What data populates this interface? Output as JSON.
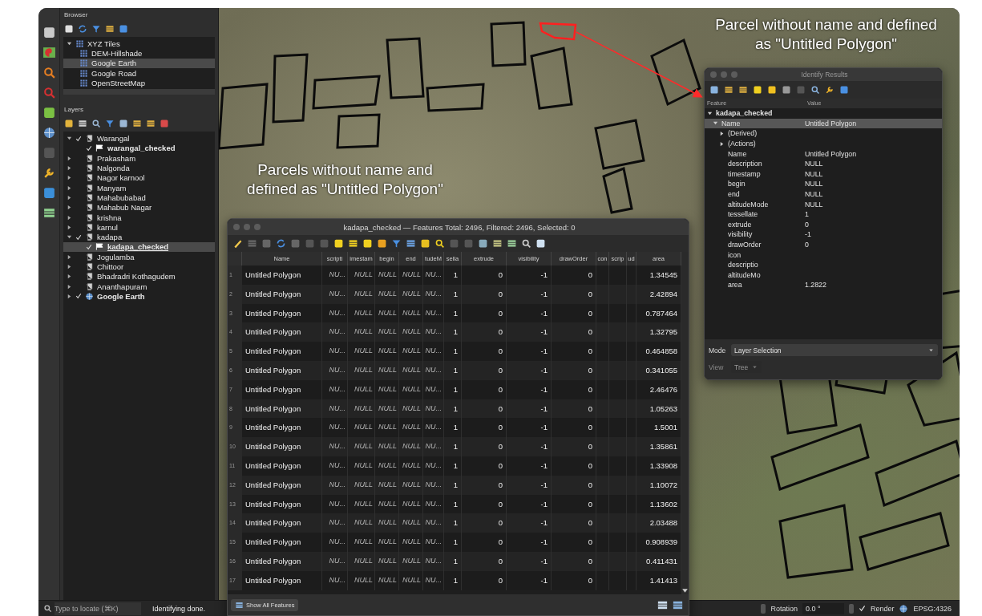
{
  "browser": {
    "title": "Browser",
    "items": [
      {
        "label": "XYZ Tiles",
        "expanded": true,
        "selected": false,
        "children": [
          {
            "label": "DEM-Hillshade",
            "selected": false
          },
          {
            "label": "Google Earth",
            "selected": true
          },
          {
            "label": "Google Road",
            "selected": false
          },
          {
            "label": "OpenStreetMap",
            "selected": false
          }
        ]
      }
    ]
  },
  "layers": {
    "title": "Layers",
    "items": [
      {
        "label": "Warangal",
        "kind": "group",
        "expanded": true,
        "checked": true,
        "selected": false,
        "children": [
          {
            "label": "warangal_checked",
            "kind": "vector",
            "checked": true,
            "selected": false
          }
        ]
      },
      {
        "label": "Prakasham",
        "kind": "group",
        "expanded": false,
        "checked": false,
        "selected": false
      },
      {
        "label": "Nalgonda",
        "kind": "group",
        "expanded": false,
        "checked": false,
        "selected": false
      },
      {
        "label": "Nagor karnool",
        "kind": "group",
        "expanded": false,
        "checked": false,
        "selected": false
      },
      {
        "label": "Manyam",
        "kind": "group",
        "expanded": false,
        "checked": false,
        "selected": false
      },
      {
        "label": "Mahabubabad",
        "kind": "group",
        "expanded": false,
        "checked": false,
        "selected": false
      },
      {
        "label": "Mahabub Nagar",
        "kind": "group",
        "expanded": false,
        "checked": false,
        "selected": false
      },
      {
        "label": "krishna",
        "kind": "group",
        "expanded": false,
        "checked": false,
        "selected": false
      },
      {
        "label": "karnul",
        "kind": "group",
        "expanded": false,
        "checked": false,
        "selected": false
      },
      {
        "label": "kadapa",
        "kind": "group",
        "expanded": true,
        "checked": true,
        "selected": false,
        "children": [
          {
            "label": "kadapa_checked",
            "kind": "vector",
            "checked": true,
            "selected": true
          }
        ]
      },
      {
        "label": "Jogulamba",
        "kind": "group",
        "expanded": false,
        "checked": false,
        "selected": false
      },
      {
        "label": "Chittoor",
        "kind": "group",
        "expanded": false,
        "checked": false,
        "selected": false
      },
      {
        "label": "Bhadradri Kothagudem",
        "kind": "group",
        "expanded": false,
        "checked": false,
        "selected": false
      },
      {
        "label": "Ananthapuram",
        "kind": "group",
        "expanded": false,
        "checked": false,
        "selected": false
      },
      {
        "label": "Google Earth",
        "kind": "raster",
        "expanded": false,
        "checked": true,
        "selected": false
      }
    ]
  },
  "map": {
    "annotations": [
      {
        "text": "Parcel without name and defined as \"Untitled Polygon\""
      },
      {
        "text": "Parcels without name and defined as \"Untitled Polygon\""
      }
    ]
  },
  "attribute_table": {
    "title": "kadapa_checked — Features Total: 2496, Filtered: 2496, Selected: 0",
    "columns": [
      "Name",
      "scripti",
      "imestam",
      "begin",
      "end",
      "tudeM",
      "sella",
      "extrude",
      "visibility",
      "drawOrder",
      "con",
      "scrip",
      "ud",
      "area"
    ],
    "rows": [
      {
        "number": "1",
        "cells": [
          "Untitled Polygon",
          "NU...",
          "NULL",
          "NULL",
          "NULL",
          "NU...",
          "1",
          "0",
          "-1",
          "0",
          null,
          null,
          null,
          "1.34545"
        ]
      },
      {
        "number": "2",
        "cells": [
          "Untitled Polygon",
          "NU...",
          "NULL",
          "NULL",
          "NULL",
          "NU...",
          "1",
          "0",
          "-1",
          "0",
          null,
          null,
          null,
          "2.42894"
        ]
      },
      {
        "number": "3",
        "cells": [
          "Untitled Polygon",
          "NU...",
          "NULL",
          "NULL",
          "NULL",
          "NU...",
          "1",
          "0",
          "-1",
          "0",
          null,
          null,
          null,
          "0.787464"
        ]
      },
      {
        "number": "4",
        "cells": [
          "Untitled Polygon",
          "NU...",
          "NULL",
          "NULL",
          "NULL",
          "NU...",
          "1",
          "0",
          "-1",
          "0",
          null,
          null,
          null,
          "1.32795"
        ]
      },
      {
        "number": "5",
        "cells": [
          "Untitled Polygon",
          "NU...",
          "NULL",
          "NULL",
          "NULL",
          "NU...",
          "1",
          "0",
          "-1",
          "0",
          null,
          null,
          null,
          "0.464858"
        ]
      },
      {
        "number": "6",
        "cells": [
          "Untitled Polygon",
          "NU...",
          "NULL",
          "NULL",
          "NULL",
          "NU...",
          "1",
          "0",
          "-1",
          "0",
          null,
          null,
          null,
          "0.341055"
        ]
      },
      {
        "number": "7",
        "cells": [
          "Untitled Polygon",
          "NU...",
          "NULL",
          "NULL",
          "NULL",
          "NU...",
          "1",
          "0",
          "-1",
          "0",
          null,
          null,
          null,
          "2.46476"
        ]
      },
      {
        "number": "8",
        "cells": [
          "Untitled Polygon",
          "NU...",
          "NULL",
          "NULL",
          "NULL",
          "NU...",
          "1",
          "0",
          "-1",
          "0",
          null,
          null,
          null,
          "1.05263"
        ]
      },
      {
        "number": "9",
        "cells": [
          "Untitled Polygon",
          "NU...",
          "NULL",
          "NULL",
          "NULL",
          "NU...",
          "1",
          "0",
          "-1",
          "0",
          null,
          null,
          null,
          "1.5001"
        ]
      },
      {
        "number": "10",
        "cells": [
          "Untitled Polygon",
          "NU...",
          "NULL",
          "NULL",
          "NULL",
          "NU...",
          "1",
          "0",
          "-1",
          "0",
          null,
          null,
          null,
          "1.35861"
        ]
      },
      {
        "number": "11",
        "cells": [
          "Untitled Polygon",
          "NU...",
          "NULL",
          "NULL",
          "NULL",
          "NU...",
          "1",
          "0",
          "-1",
          "0",
          null,
          null,
          null,
          "1.33908"
        ]
      },
      {
        "number": "12",
        "cells": [
          "Untitled Polygon",
          "NU...",
          "NULL",
          "NULL",
          "NULL",
          "NU...",
          "1",
          "0",
          "-1",
          "0",
          null,
          null,
          null,
          "1.10072"
        ]
      },
      {
        "number": "13",
        "cells": [
          "Untitled Polygon",
          "NU...",
          "NULL",
          "NULL",
          "NULL",
          "NU...",
          "1",
          "0",
          "-1",
          "0",
          null,
          null,
          null,
          "1.13602"
        ]
      },
      {
        "number": "14",
        "cells": [
          "Untitled Polygon",
          "NU...",
          "NULL",
          "NULL",
          "NULL",
          "NU...",
          "1",
          "0",
          "-1",
          "0",
          null,
          null,
          null,
          "2.03488"
        ]
      },
      {
        "number": "15",
        "cells": [
          "Untitled Polygon",
          "NU...",
          "NULL",
          "NULL",
          "NULL",
          "NU...",
          "1",
          "0",
          "-1",
          "0",
          null,
          null,
          null,
          "0.908939"
        ]
      },
      {
        "number": "16",
        "cells": [
          "Untitled Polygon",
          "NU...",
          "NULL",
          "NULL",
          "NULL",
          "NU...",
          "1",
          "0",
          "-1",
          "0",
          null,
          null,
          null,
          "0.411431"
        ]
      },
      {
        "number": "17",
        "cells": [
          "Untitled Polygon",
          "NU...",
          "NULL",
          "NULL",
          "NULL",
          "NU...",
          "1",
          "0",
          "-1",
          "0",
          null,
          null,
          null,
          "1.41413"
        ]
      }
    ],
    "filter_button": "Show All Features"
  },
  "identify_results": {
    "title": "Identify Results",
    "columns": [
      "Feature",
      "Value"
    ],
    "tree": [
      {
        "label": "kadapa_checked",
        "expanded": true,
        "selected": false,
        "children": [
          {
            "label": "Name",
            "value": "Untitled Polygon",
            "expanded": true,
            "selected": true,
            "children": [
              {
                "label": "(Derived)",
                "kind": "section",
                "expanded": false
              },
              {
                "label": "(Actions)",
                "kind": "section",
                "expanded": false
              },
              {
                "label": "Name",
                "value": "Untitled Polygon",
                "kind": "attribute"
              },
              {
                "label": "description",
                "value": "NULL",
                "kind": "attribute"
              },
              {
                "label": "timestamp",
                "value": "NULL",
                "kind": "attribute"
              },
              {
                "label": "begin",
                "value": "NULL",
                "kind": "attribute"
              },
              {
                "label": "end",
                "value": "NULL",
                "kind": "attribute"
              },
              {
                "label": "altitudeMode",
                "value": "NULL",
                "kind": "attribute"
              },
              {
                "label": "tessellate",
                "value": "1",
                "kind": "attribute"
              },
              {
                "label": "extrude",
                "value": "0",
                "kind": "attribute"
              },
              {
                "label": "visibility",
                "value": "-1",
                "kind": "attribute"
              },
              {
                "label": "drawOrder",
                "value": "0",
                "kind": "attribute"
              },
              {
                "label": "icon",
                "kind": "attribute"
              },
              {
                "label": "descriptio",
                "kind": "attribute"
              },
              {
                "label": "altitudeMo",
                "kind": "attribute"
              },
              {
                "label": "area",
                "value": "1.2822",
                "kind": "attribute"
              }
            ]
          }
        ]
      }
    ],
    "mode_label": "Mode",
    "mode": "Layer Selection",
    "view_label": "View",
    "view": "Tree",
    "view_disabled": true
  },
  "status_bar": {
    "locator_placeholder": "Type to locate (⌘K)",
    "message": "Identifying done.",
    "rotation_label": "Rotation",
    "rotation": "0.0 °",
    "render_label": "Render",
    "render_checked": true,
    "crs": "EPSG:4326"
  }
}
